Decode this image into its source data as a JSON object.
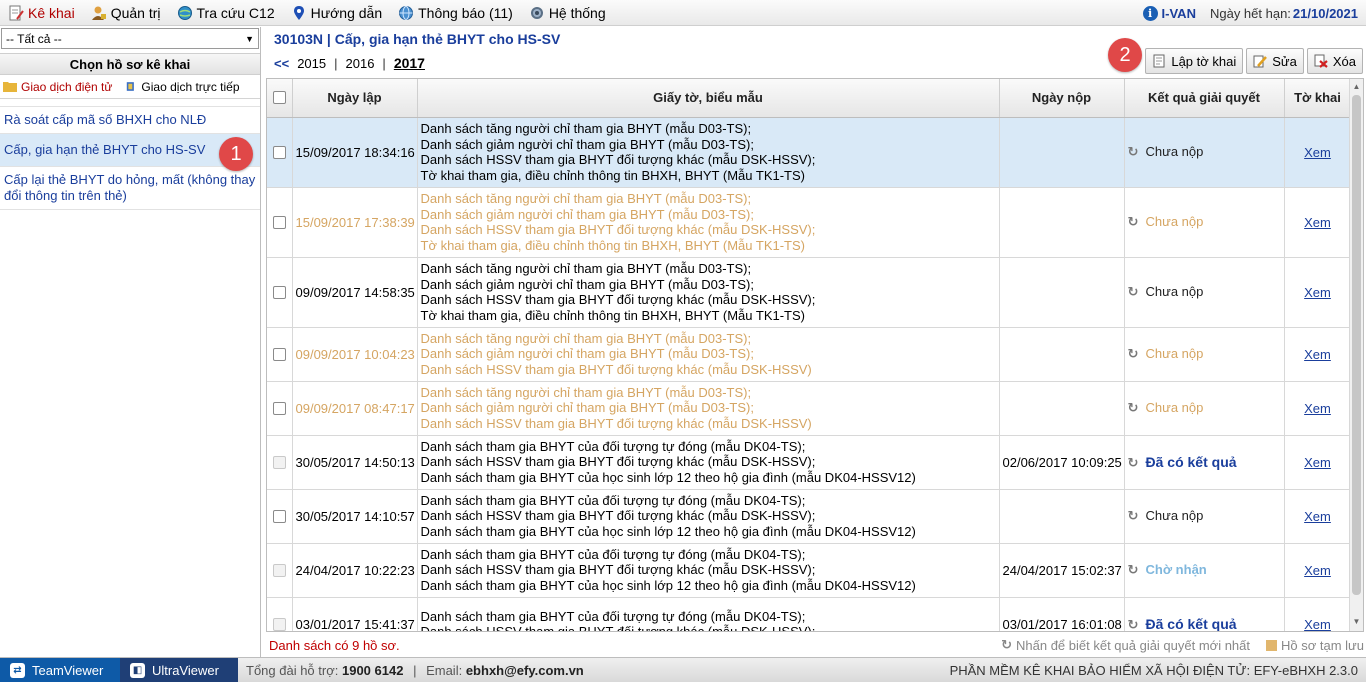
{
  "menu": {
    "items": [
      {
        "label": "Kê khai",
        "icon": "document-pen-icon"
      },
      {
        "label": "Quản trị",
        "icon": "admin-user-icon"
      },
      {
        "label": "Tra cứu C12",
        "icon": "globe-search-icon"
      },
      {
        "label": "Hướng dẫn",
        "icon": "map-pin-icon"
      },
      {
        "label": "Thông báo (11)",
        "icon": "notification-globe-icon"
      },
      {
        "label": "Hệ thống",
        "icon": "gear-icon"
      }
    ],
    "ivan": "I-VAN",
    "expire_label": "Ngày hết hạn:",
    "expire_value": "21/10/2021"
  },
  "left": {
    "filter_value": "-- Tất cả --",
    "panel_title": "Chọn hồ sơ kê khai",
    "tabs": [
      "Giao dịch điện tử",
      "Giao dịch trực tiếp"
    ],
    "items": [
      "Rà soát cấp mã số BHXH cho NLĐ",
      "Cấp, gia hạn thẻ BHYT cho HS-SV",
      "Cấp lại thẻ BHYT do hỏng, mất (không thay đổi thông tin trên thẻ)"
    ],
    "badge": "1"
  },
  "main": {
    "title": "30103N | Cấp, gia hạn thẻ BHYT cho HS-SV",
    "years": {
      "prev": "<<",
      "list": [
        "2015",
        "2016",
        "2017"
      ],
      "sep": "|"
    },
    "toolbar": {
      "create": "Lập tờ khai",
      "edit": "Sửa",
      "delete": "Xóa",
      "badge": "2"
    },
    "columns": {
      "date": "Ngày lập",
      "docs": "Giấy tờ, biểu mẫu",
      "submitted": "Ngày nộp",
      "result": "Kết quả giải quyết",
      "form": "Tờ khai"
    },
    "rows": [
      {
        "date": "15/09/2017 18:34:16",
        "docs": [
          "Danh sách tăng người chỉ tham gia BHYT (mẫu D03-TS);",
          "Danh sách giảm người chỉ tham gia BHYT (mẫu D03-TS);",
          "Danh sách HSSV tham gia BHYT đối tượng khác (mẫu DSK-HSSV);",
          "Tờ khai tham gia, điều chỉnh thông tin BHXH, BHYT (Mẫu TK1-TS)"
        ],
        "submitted": "",
        "result": "Chưa nộp",
        "view": "Xem"
      },
      {
        "date": "15/09/2017 17:38:39",
        "docs": [
          "Danh sách tăng người chỉ tham gia BHYT (mẫu D03-TS);",
          "Danh sách giảm người chỉ tham gia BHYT (mẫu D03-TS);",
          "Danh sách HSSV tham gia BHYT đối tượng khác (mẫu DSK-HSSV);",
          "Tờ khai tham gia, điều chỉnh thông tin BHXH, BHYT (Mẫu TK1-TS)"
        ],
        "submitted": "",
        "result": "Chưa nộp",
        "view": "Xem"
      },
      {
        "date": "09/09/2017 14:58:35",
        "docs": [
          "Danh sách tăng người chỉ tham gia BHYT (mẫu D03-TS);",
          "Danh sách giảm người chỉ tham gia BHYT (mẫu D03-TS);",
          "Danh sách HSSV tham gia BHYT đối tượng khác (mẫu DSK-HSSV);",
          "Tờ khai tham gia, điều chỉnh thông tin BHXH, BHYT (Mẫu TK1-TS)"
        ],
        "submitted": "",
        "result": "Chưa nộp",
        "view": "Xem"
      },
      {
        "date": "09/09/2017 10:04:23",
        "docs": [
          "Danh sách tăng người chỉ tham gia BHYT (mẫu D03-TS);",
          "Danh sách giảm người chỉ tham gia BHYT (mẫu D03-TS);",
          "Danh sách HSSV tham gia BHYT đối tượng khác (mẫu DSK-HSSV)"
        ],
        "submitted": "",
        "result": "Chưa nộp",
        "view": "Xem"
      },
      {
        "date": "09/09/2017 08:47:17",
        "docs": [
          "Danh sách tăng người chỉ tham gia BHYT (mẫu D03-TS);",
          "Danh sách giảm người chỉ tham gia BHYT (mẫu D03-TS);",
          "Danh sách HSSV tham gia BHYT đối tượng khác (mẫu DSK-HSSV)"
        ],
        "submitted": "",
        "result": "Chưa nộp",
        "view": "Xem"
      },
      {
        "date": "30/05/2017 14:50:13",
        "docs": [
          "Danh sách tham gia BHYT của đối tượng tự đóng (mẫu DK04-TS);",
          "Danh sách HSSV tham gia BHYT đối tượng khác (mẫu DSK-HSSV);",
          "Danh sách tham gia BHYT của học sinh lớp 12 theo hộ gia đình (mẫu DK04-HSSV12)"
        ],
        "submitted": "02/06/2017 10:09:25",
        "result": "Đã có kết quả",
        "view": "Xem"
      },
      {
        "date": "30/05/2017 14:10:57",
        "docs": [
          "Danh sách tham gia BHYT của đối tượng tự đóng (mẫu DK04-TS);",
          "Danh sách HSSV tham gia BHYT đối tượng khác (mẫu DSK-HSSV);",
          "Danh sách tham gia BHYT của học sinh lớp 12 theo hộ gia đình (mẫu DK04-HSSV12)"
        ],
        "submitted": "",
        "result": "Chưa nộp",
        "view": "Xem"
      },
      {
        "date": "24/04/2017 10:22:23",
        "docs": [
          "Danh sách tham gia BHYT của đối tượng tự đóng (mẫu DK04-TS);",
          "Danh sách HSSV tham gia BHYT đối tượng khác (mẫu DSK-HSSV);",
          "Danh sách tham gia BHYT của học sinh lớp 12 theo hộ gia đình (mẫu DK04-HSSV12)"
        ],
        "submitted": "24/04/2017 15:02:37",
        "result": "Chờ nhận",
        "view": "Xem"
      },
      {
        "date": "03/01/2017 15:41:37",
        "docs": [
          "Danh sách tham gia BHYT của đối tượng tự đóng (mẫu DK04-TS);",
          "Danh sách HSSV tham gia BHYT đối tượng khác (mẫu DSK-HSSV);"
        ],
        "submitted": "03/01/2017 16:01:08",
        "result": "Đã có kết quả",
        "view": "Xem"
      }
    ],
    "count_text": "Danh sách có 9 hồ sơ.",
    "legend_refresh": "Nhấn để biết kết quả giải quyết mới nhất",
    "legend_temp": "Hồ sơ tạm lưu"
  },
  "statusbar": {
    "teamviewer": "TeamViewer",
    "ultraviewer": "UltraViewer",
    "support_label": "Tổng đài hỗ trợ:",
    "support_phone": "1900 6142",
    "email_label": "Email:",
    "email": "ebhxh@efy.com.vn",
    "product": "PHẦN MỀM KÊ KHAI BẢO HIỂM XÃ HỘI ĐIỆN TỬ: EFY-eBHXH 2.3.0"
  },
  "colors": {
    "link": "#1a3e9c",
    "selected_row": "#d9e9f7",
    "temp_saved": "#d5a562",
    "badge": "#e04848",
    "pending_result": "#7fb7dd"
  }
}
